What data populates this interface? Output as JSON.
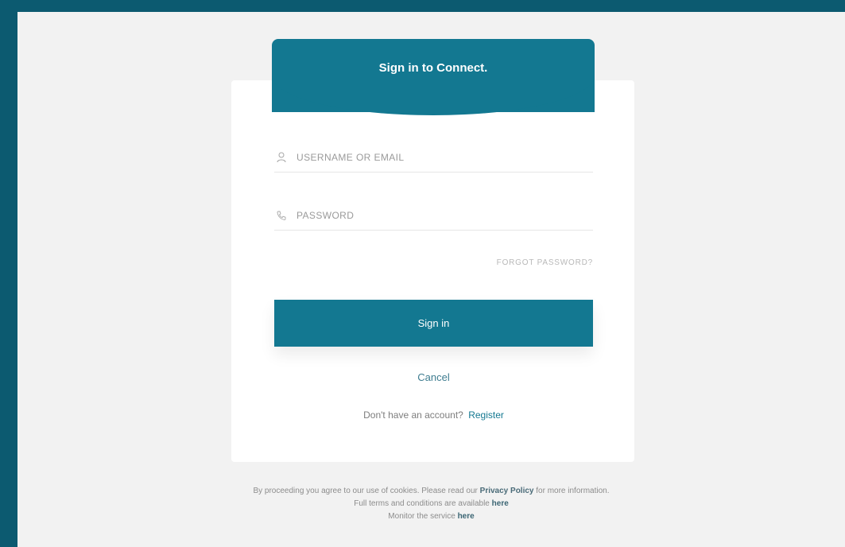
{
  "header": {
    "title": "Sign in to Connect."
  },
  "form": {
    "username_placeholder": "USERNAME OR EMAIL",
    "password_placeholder": "PASSWORD",
    "forgot_password": "FORGOT PASSWORD?",
    "sign_in_label": "Sign in",
    "cancel_label": "Cancel",
    "register_prompt": "Don't have an account?",
    "register_label": "Register"
  },
  "footer": {
    "line1_prefix": "By proceeding you agree to our use of cookies. Please read our",
    "privacy_label": "Privacy Policy",
    "line1_suffix": "for more information.",
    "line2_prefix": "Full terms and conditions are available",
    "here_label_1": "here",
    "line3_prefix": "Monitor the service",
    "here_label_2": "here"
  },
  "colors": {
    "frame": "#0c5a70",
    "accent": "#137891",
    "page_background": "#f2f2f2",
    "card_background": "#ffffff"
  },
  "icons": {
    "username": "user-icon",
    "password": "phone-icon"
  }
}
